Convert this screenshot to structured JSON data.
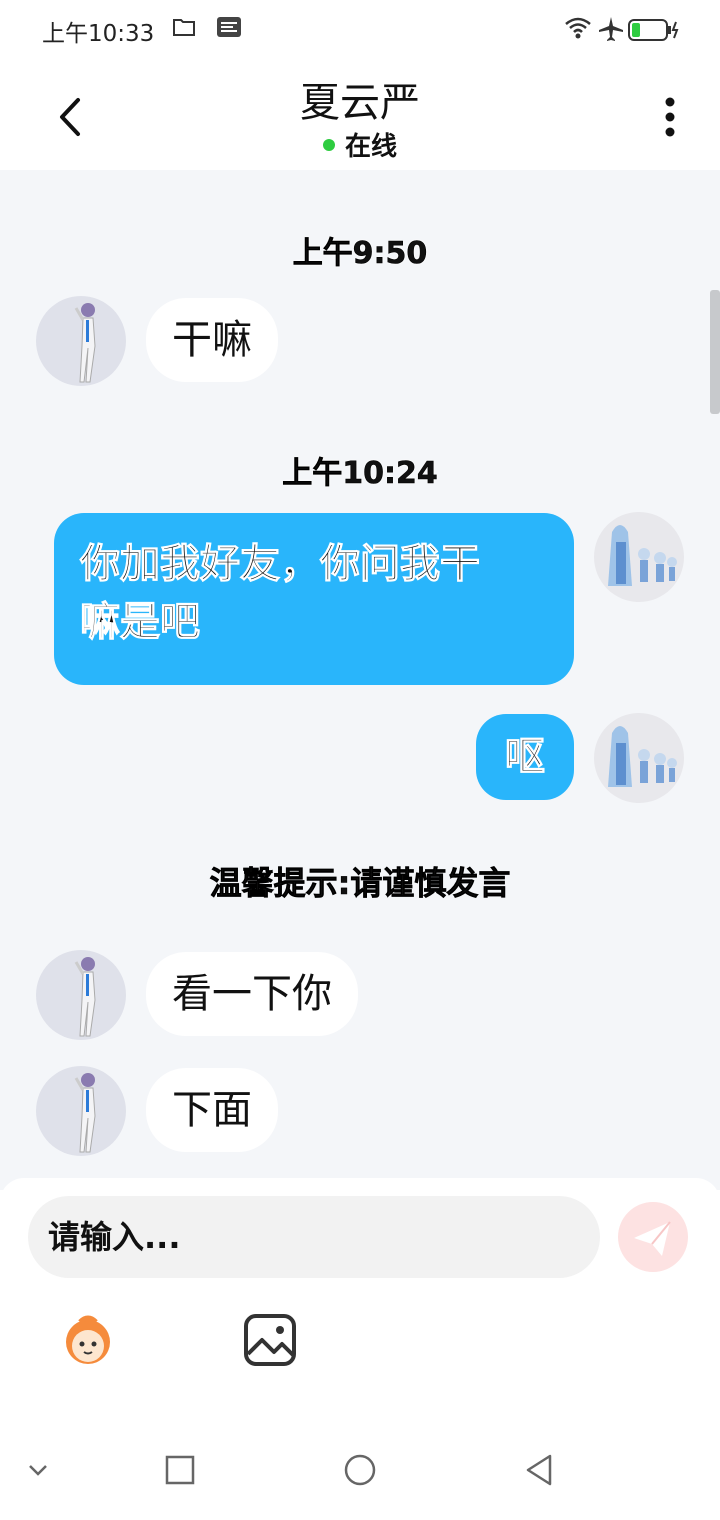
{
  "status_bar": {
    "time": "上午10:33",
    "icons": [
      "folder-icon",
      "message-icon",
      "wifi-icon",
      "airplane-icon",
      "battery-icon"
    ]
  },
  "header": {
    "title": "夏云严",
    "status": "在线",
    "status_color": "#2ecc40",
    "back_icon": "chevron-left-icon",
    "more_icon": "more-vertical-icon"
  },
  "chat": {
    "messages": [
      {
        "type": "time",
        "text": "上午9:50"
      },
      {
        "type": "incoming",
        "text": "干嘛"
      },
      {
        "type": "time",
        "text": "上午10:24"
      },
      {
        "type": "outgoing",
        "line1": "你加我好友，你问我干",
        "line2": "嘛是吧"
      },
      {
        "type": "outgoing",
        "text": "呕"
      },
      {
        "type": "tip",
        "text": "温馨提示:请谨慎发言"
      },
      {
        "type": "incoming",
        "text": "看一下你"
      },
      {
        "type": "incoming",
        "text": "下面"
      }
    ],
    "outgoing_bubble_color": "#29b5fb",
    "incoming_bubble_color": "#ffffff"
  },
  "composer": {
    "placeholder": "请输入...",
    "send_icon": "send-icon",
    "tools": [
      "emoji-mascot-icon",
      "image-icon"
    ]
  },
  "nav_bar": {
    "items": [
      "chevron-down-icon",
      "square-icon",
      "circle-icon",
      "triangle-back-icon"
    ]
  }
}
